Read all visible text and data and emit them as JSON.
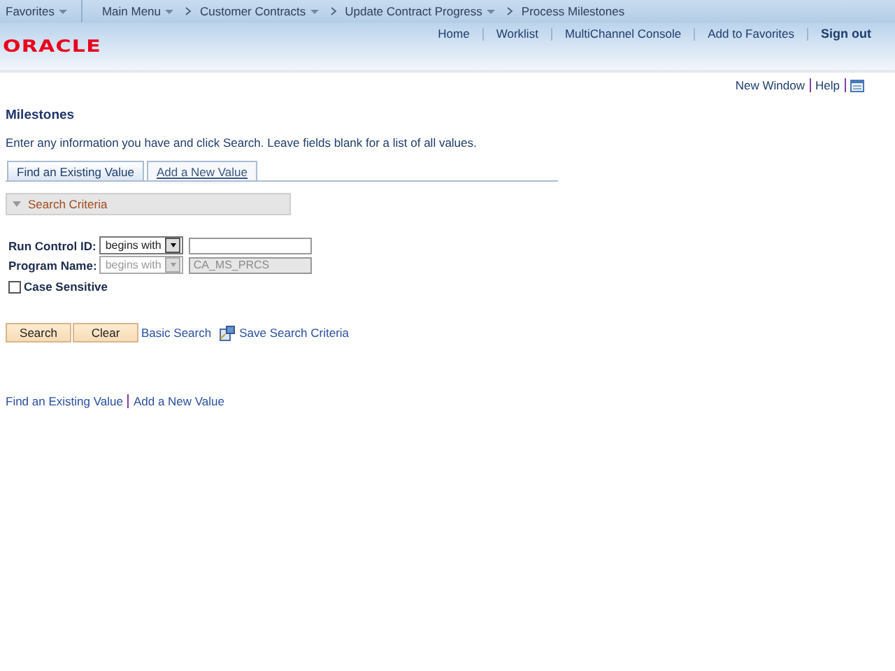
{
  "nav": {
    "favorites": "Favorites",
    "main_menu": "Main Menu",
    "crumbs": [
      {
        "label": "Customer Contracts",
        "dropdown": true
      },
      {
        "label": "Update Contract Progress",
        "dropdown": true
      },
      {
        "label": "Process Milestones",
        "dropdown": false
      }
    ]
  },
  "logo": "ORACLE",
  "header_links": [
    {
      "label": "Home",
      "bold": false
    },
    {
      "label": "Worklist",
      "bold": false
    },
    {
      "label": "MultiChannel Console",
      "bold": false
    },
    {
      "label": "Add to Favorites",
      "bold": false
    },
    {
      "label": "Sign out",
      "bold": true
    }
  ],
  "util_links": [
    "New Window",
    "Help"
  ],
  "title": "Milestones",
  "instructions": "Enter any information you have and click Search. Leave fields blank for a list of all values.",
  "tabs": [
    {
      "label": "Find an Existing Value",
      "selected": true
    },
    {
      "label": "Add a New Value",
      "selected": false
    }
  ],
  "search_criteria": {
    "label": "Search Criteria",
    "expanded": true
  },
  "fields": [
    {
      "label": "Run Control ID:",
      "operator": "begins with",
      "disabled": false
    },
    {
      "label": "Program Name:",
      "operator": "begins with",
      "value": "CA_MS_PRCS",
      "disabled": true
    }
  ],
  "case_sensitive": {
    "label": "Case Sensitive",
    "checked": false
  },
  "buttons": [
    "Search",
    "Clear"
  ],
  "links": [
    "Basic Search",
    "Save Search Criteria"
  ],
  "footer_links": [
    "Find an Existing Value",
    "Add a New Value"
  ]
}
